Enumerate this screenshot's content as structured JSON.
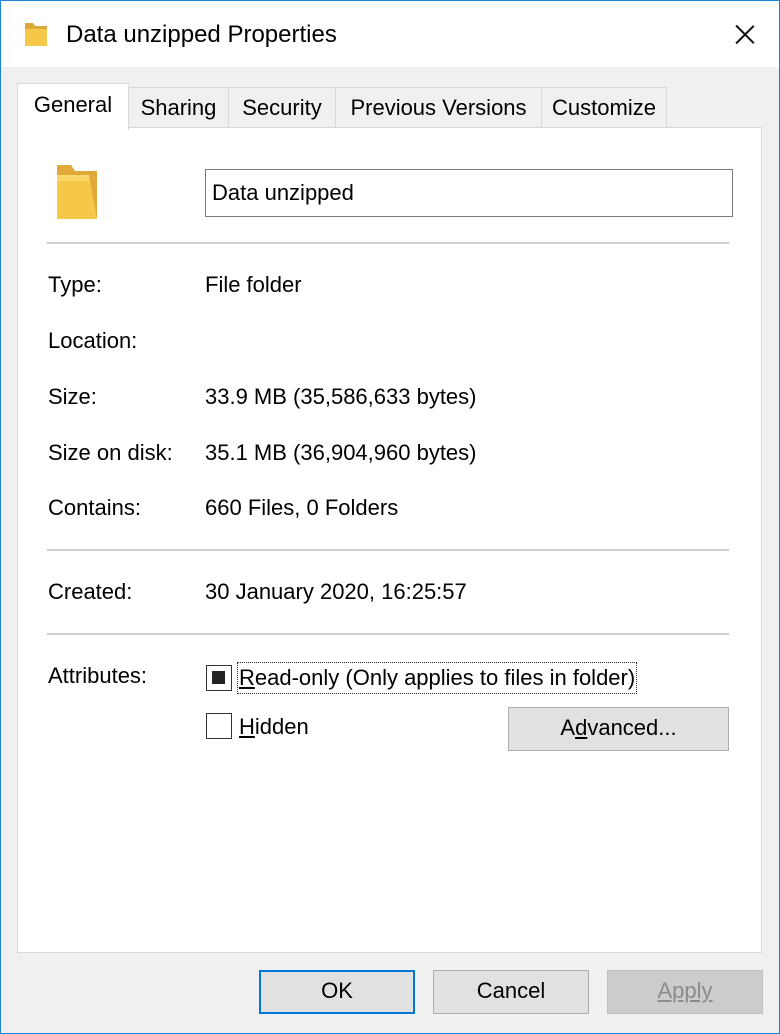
{
  "window": {
    "title": "Data unzipped Properties",
    "icon": "folder-icon",
    "close_icon": "close-icon"
  },
  "tabs": [
    {
      "label": "General",
      "active": true
    },
    {
      "label": "Sharing",
      "active": false
    },
    {
      "label": "Security",
      "active": false
    },
    {
      "label": "Previous Versions",
      "active": false
    },
    {
      "label": "Customize",
      "active": false
    }
  ],
  "general": {
    "folder_name": "Data unzipped",
    "type_label": "Type:",
    "type_value": "File folder",
    "location_label": "Location:",
    "location_value": "",
    "size_label": "Size:",
    "size_value": "33.9 MB (35,586,633 bytes)",
    "size_on_disk_label": "Size on disk:",
    "size_on_disk_value": "35.1 MB (36,904,960 bytes)",
    "contains_label": "Contains:",
    "contains_value": "660 Files, 0 Folders",
    "created_label": "Created:",
    "created_value": "30 January 2020, 16:25:57",
    "attributes_label": "Attributes:",
    "readonly": {
      "label_first": "R",
      "label_rest": "ead-only (Only applies to files in folder)",
      "state": "indeterminate"
    },
    "hidden": {
      "label_first": "H",
      "label_rest": "idden",
      "state": "unchecked"
    },
    "advanced": {
      "label_pre": "A",
      "label_u": "d",
      "label_post": "vanced..."
    }
  },
  "buttons": {
    "ok": "OK",
    "cancel": "Cancel",
    "apply": "Apply"
  },
  "colors": {
    "accent": "#0078d7",
    "folder": "#f4c440"
  }
}
